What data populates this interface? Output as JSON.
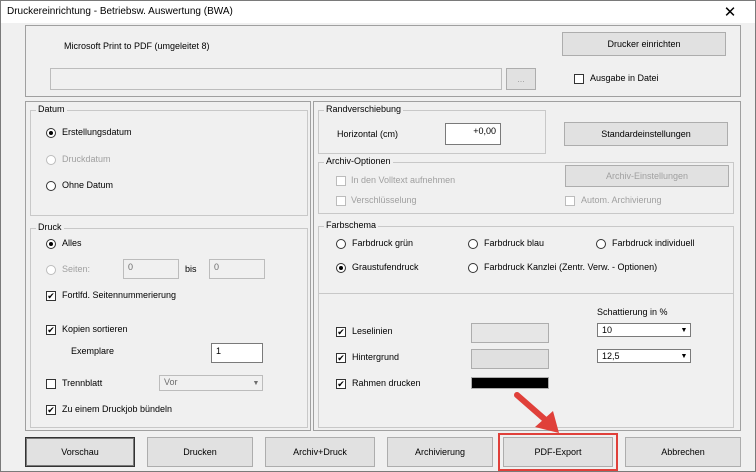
{
  "window": {
    "title": "Druckereinrichtung - Betriebsw. Auswertung (BWA)",
    "close_glyph": "✕"
  },
  "printer": {
    "name": "Microsoft Print to PDF (umgeleitet 8)",
    "setup_button": "Drucker einrichten",
    "path_value": "",
    "browse_label": "...",
    "file_output_label": "Ausgabe in Datei",
    "file_output_checked": false
  },
  "datum": {
    "title": "Datum",
    "options": [
      "Erstellungsdatum",
      "Druckdatum",
      "Ohne Datum"
    ],
    "selected": "Erstellungsdatum"
  },
  "rand": {
    "title": "Randverschiebung",
    "horizontal_label": "Horizontal (cm)",
    "horizontal_value": "+0,00",
    "standard_button": "Standardeinstellungen"
  },
  "archiv": {
    "title": "Archiv-Optionen",
    "volltext_label": "In den Volltext aufnehmen",
    "verschluesselung_label": "Verschlüsselung",
    "settings_button": "Archiv-Einstellungen",
    "auto_label": "Autom. Archivierung"
  },
  "druck": {
    "title": "Druck",
    "alles_label": "Alles",
    "seiten_label": "Seiten:",
    "seiten_from": "0",
    "bis_label": "bis",
    "seiten_to": "0",
    "fortlfd_label": "Fortlfd. Seitennummerierung",
    "fortlfd_checked": true,
    "kopien_label": "Kopien sortieren",
    "kopien_checked": true,
    "exemplare_label": "Exemplare",
    "exemplare_value": "1",
    "trennblatt_label": "Trennblatt",
    "trennblatt_checked": false,
    "trennblatt_select": "Vor",
    "buendeln_label": "Zu einem Druckjob bündeln",
    "buendeln_checked": true
  },
  "farbschema": {
    "title": "Farbschema",
    "options": [
      "Farbdruck grün",
      "Farbdruck blau",
      "Farbdruck individuell",
      "Graustufendruck",
      "Farbdruck Kanzlei (Zentr. Verw. - Optionen)"
    ],
    "selected": "Graustufendruck",
    "schattierung_label": "Schattierung in %",
    "leselinien_label": "Leselinien",
    "leselinien_checked": true,
    "leselinien_value": "10",
    "hintergrund_label": "Hintergrund",
    "hintergrund_checked": true,
    "hintergrund_value": "12,5",
    "rahmen_label": "Rahmen drucken",
    "rahmen_checked": true,
    "colors": {
      "leselinien": "#e6e6e6",
      "hintergrund": "#e0e0e0",
      "rahmen": "#000000"
    }
  },
  "footer": {
    "vorschau": "Vorschau",
    "drucken": "Drucken",
    "archiv_druck": "Archiv+Druck",
    "archivierung": "Archivierung",
    "pdf_export": "PDF-Export",
    "abbrechen": "Abbrechen"
  },
  "annotation": {
    "color": "#e0403a"
  },
  "check_glyph": "✔",
  "dropdown_glyph": "▼"
}
